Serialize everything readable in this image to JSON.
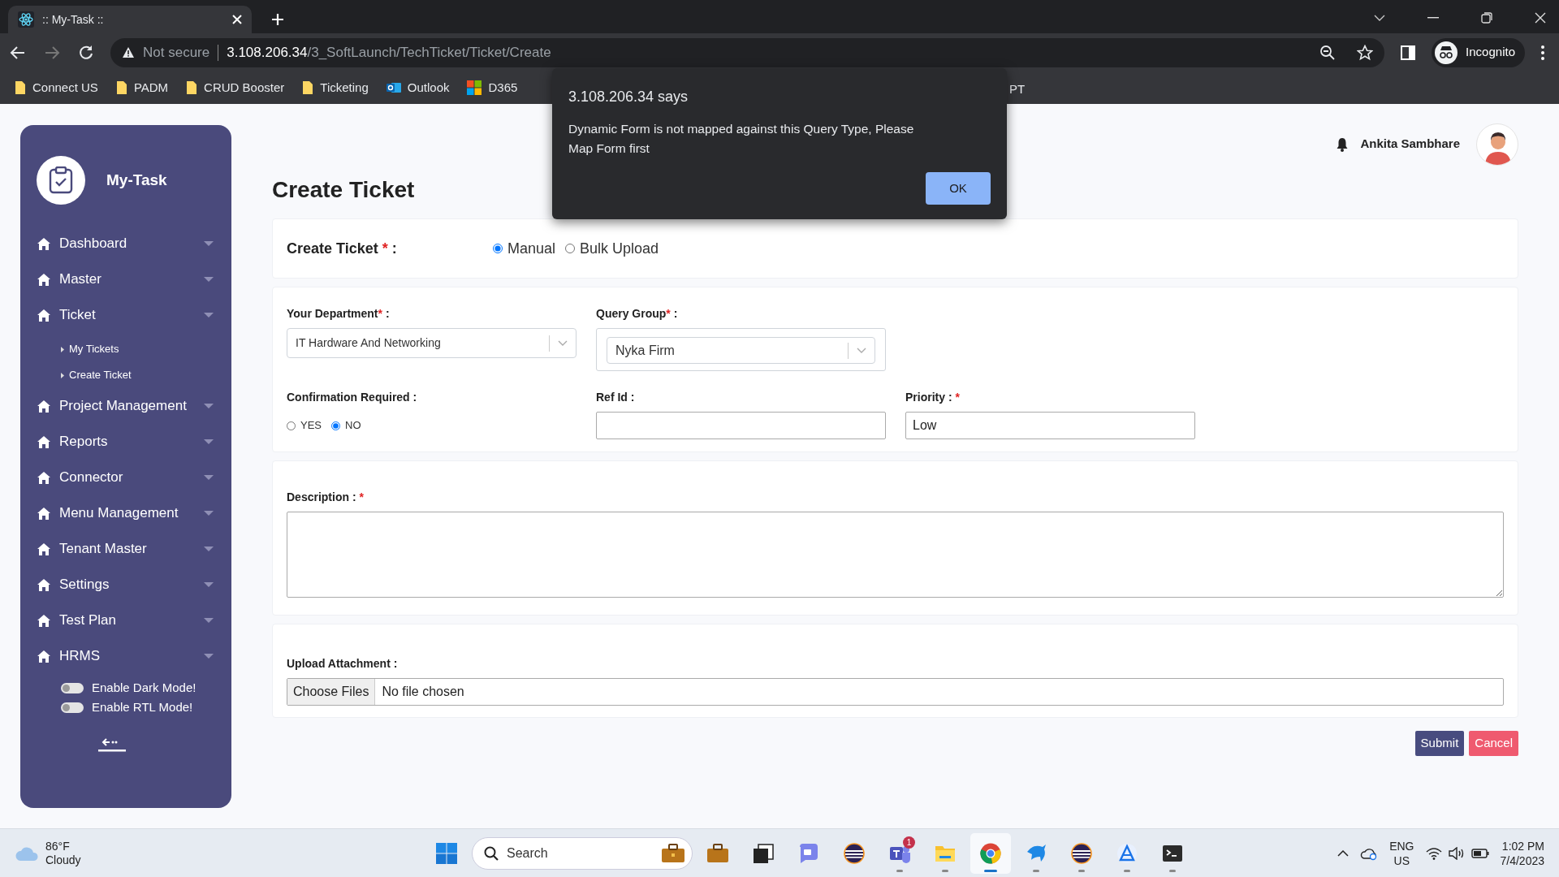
{
  "browser": {
    "tab_title": ":: My-Task ::",
    "security": "Not secure",
    "url_host": "3.108.206.34",
    "url_path": "/3_SoftLaunch/TechTicket/Ticket/Create",
    "profile": "Incognito",
    "bookmarks": [
      {
        "label": "Connect US",
        "kind": "folder"
      },
      {
        "label": "PADM",
        "kind": "folder"
      },
      {
        "label": "CRUD Booster",
        "kind": "folder"
      },
      {
        "label": "Ticketing",
        "kind": "folder"
      },
      {
        "label": "Outlook",
        "kind": "mail"
      },
      {
        "label": "D365",
        "kind": "squares"
      },
      {
        "label": "PT",
        "kind": "covered"
      }
    ]
  },
  "dialog": {
    "title": "3.108.206.34 says",
    "message": "Dynamic Form is not mapped against this Query Type, Please Map Form first",
    "button": "OK"
  },
  "sidebar": {
    "brand": "My-Task",
    "items": [
      {
        "label": "Dashboard"
      },
      {
        "label": "Master"
      },
      {
        "label": "Ticket",
        "children": [
          {
            "label": "My Tickets"
          },
          {
            "label": "Create Ticket"
          }
        ]
      },
      {
        "label": "Project Management"
      },
      {
        "label": "Reports"
      },
      {
        "label": "Connector"
      },
      {
        "label": "Menu Management"
      },
      {
        "label": "Tenant Master"
      },
      {
        "label": "Settings"
      },
      {
        "label": "Test Plan"
      },
      {
        "label": "HRMS"
      }
    ],
    "toggles": [
      {
        "label": "Enable Dark Mode!",
        "on": false
      },
      {
        "label": "Enable RTL Mode!",
        "on": false
      }
    ]
  },
  "header": {
    "user_name": "Ankita Sambhare"
  },
  "page_title": "Create Ticket",
  "mode": {
    "label": [
      {
        "text": "Create Ticket "
      },
      {
        "text": "*",
        "kind": "required"
      },
      {
        "text": " :"
      }
    ],
    "options": [
      {
        "label": "Manual",
        "selected": true
      },
      {
        "label": "Bulk Upload",
        "selected": false
      }
    ]
  },
  "fields": [
    {
      "kind": "select",
      "label": [
        {
          "text": "Your Department"
        },
        {
          "text": "*",
          "kind": "required"
        },
        {
          "text": " :"
        }
      ],
      "value": "IT Hardware And Networking"
    },
    {
      "kind": "framed-select",
      "label": [
        {
          "text": "Query Group"
        },
        {
          "text": "*",
          "kind": "required"
        },
        {
          "text": " :"
        }
      ],
      "value": "Nyka Firm"
    },
    {
      "kind": "break"
    },
    {
      "kind": "radios",
      "label": [
        {
          "text": "Confirmation Required :"
        }
      ],
      "options": [
        {
          "label": "YES",
          "selected": false
        },
        {
          "label": "NO",
          "selected": true
        }
      ]
    },
    {
      "kind": "input",
      "label": [
        {
          "text": "Ref Id :"
        }
      ]
    },
    {
      "kind": "input",
      "label": [
        {
          "text": "Priority : "
        },
        {
          "text": "*",
          "kind": "required"
        }
      ],
      "value": "Low"
    }
  ],
  "description": {
    "label": [
      {
        "text": "Description : "
      },
      {
        "text": "*",
        "kind": "required"
      }
    ]
  },
  "upload": {
    "label": "Upload Attachment :",
    "button": "Choose Files",
    "status": "No file chosen"
  },
  "actions": [
    {
      "label": "Submit",
      "kind": "primary"
    },
    {
      "label": "Cancel",
      "kind": "danger"
    }
  ],
  "taskbar": {
    "temperature": "86°F",
    "condition": "Cloudy",
    "search": "Search",
    "apps": [
      {
        "kind": "briefcase",
        "selected": false,
        "running": false
      },
      {
        "kind": "windows",
        "selected": false,
        "running": false
      },
      {
        "kind": "chat",
        "selected": false,
        "running": false
      },
      {
        "kind": "striped",
        "selected": false,
        "running": false
      },
      {
        "kind": "people",
        "selected": false,
        "running": true,
        "badge": "1"
      },
      {
        "kind": "folder",
        "selected": false,
        "running": true
      },
      {
        "kind": "ring",
        "selected": true,
        "running": true
      },
      {
        "kind": "dolphin",
        "selected": false,
        "running": true
      },
      {
        "kind": "striped",
        "selected": false,
        "running": true
      },
      {
        "kind": "triangle",
        "selected": false,
        "running": true
      },
      {
        "kind": "terminal",
        "selected": false,
        "running": true
      }
    ],
    "language": "ENG",
    "region": "US",
    "time": "1:02 PM",
    "date": "7/4/2023"
  }
}
